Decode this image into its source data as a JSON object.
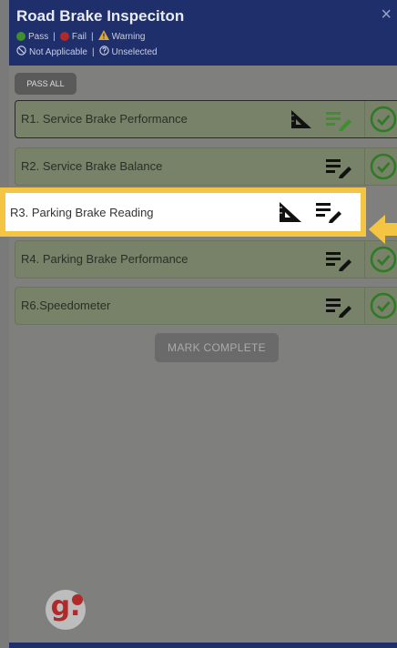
{
  "header": {
    "title": "Road Brake Inspeciton",
    "close_glyph": "×",
    "legend_line1": [
      {
        "icon": "pass-icon",
        "label": "Pass",
        "color": "#3f8f2f"
      },
      {
        "icon": "fail-icon",
        "label": "Fail",
        "color": "#b02a2a"
      },
      {
        "icon": "warning-icon",
        "label": "Warning",
        "color": "#e0a82e"
      }
    ],
    "legend_line2": [
      {
        "icon": "not-applicable-icon",
        "label": "Not Applicable"
      },
      {
        "icon": "unselected-icon",
        "label": "Unselected"
      }
    ],
    "separator": "|"
  },
  "toolbar": {
    "pass_all_label": "PASS ALL"
  },
  "items": [
    {
      "label": "R1. Service Brake Performance",
      "has_ruler": true,
      "status": "pass"
    },
    {
      "label": "R2. Service Brake Balance",
      "has_ruler": false,
      "status": "pass"
    },
    {
      "label": "R3. Parking Brake Reading",
      "has_ruler": true,
      "status": "pass",
      "highlighted": true
    },
    {
      "label": "R4. Parking Brake Performance",
      "has_ruler": false,
      "status": "pass"
    },
    {
      "label": "R6.Speedometer",
      "has_ruler": false,
      "status": "pass"
    }
  ],
  "footer": {
    "mark_complete_label": "MARK COMPLETE"
  },
  "logo": {
    "text": "g."
  },
  "colors": {
    "header_bg": "#1f2f6b",
    "pass_green": "#3f8f2f",
    "highlight_border": "#f4c542",
    "arrow": "#f4c542"
  }
}
